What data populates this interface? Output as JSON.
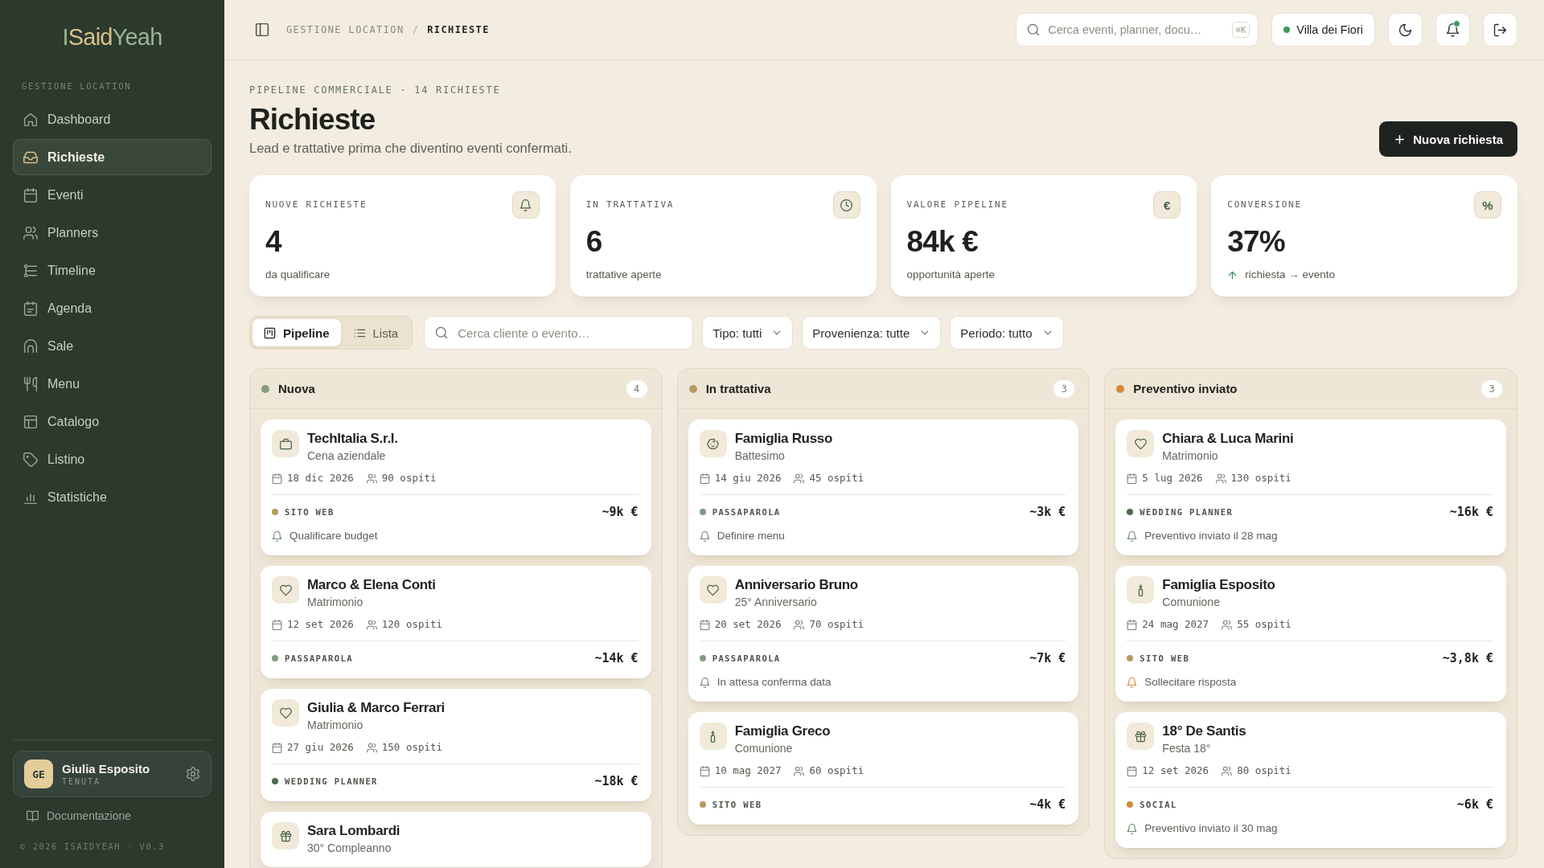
{
  "sidebar": {
    "logo": [
      "I",
      "Said",
      "Yeah"
    ],
    "section_label": "GESTIONE LOCATION",
    "items": [
      {
        "label": "Dashboard",
        "kind": "dashboard",
        "selected": false
      },
      {
        "label": "Richieste",
        "kind": "requests",
        "selected": true
      },
      {
        "label": "Eventi",
        "kind": "events",
        "selected": false
      },
      {
        "label": "Planners",
        "kind": "planners",
        "selected": false
      },
      {
        "label": "Timeline",
        "kind": "timeline",
        "selected": false
      },
      {
        "label": "Agenda",
        "kind": "agenda",
        "selected": false
      },
      {
        "label": "Sale",
        "kind": "rooms",
        "selected": false
      },
      {
        "label": "Menu",
        "kind": "menu",
        "selected": false
      },
      {
        "label": "Catalogo",
        "kind": "catalog",
        "selected": false
      },
      {
        "label": "Listino",
        "kind": "pricing",
        "selected": false
      },
      {
        "label": "Statistiche",
        "kind": "stats",
        "selected": false
      }
    ],
    "user": {
      "initials": "GE",
      "name": "Giulia Esposito",
      "role": "TENUTA"
    },
    "docs_link": "Documentazione",
    "footer": "© 2026 ISAIDYEAH · V0.3"
  },
  "topbar": {
    "breadcrumb": [
      {
        "label": "GESTIONE LOCATION",
        "current": false
      },
      {
        "label": "RICHIESTE",
        "current": true
      }
    ],
    "breadcrumb_separator": "/",
    "search": {
      "placeholder": "Cerca eventi, planner, docu…",
      "shortcut": "⌘K"
    },
    "venue": {
      "label": "Villa dei Fiori",
      "online": true
    },
    "actions": [
      {
        "kind": "theme"
      },
      {
        "kind": "notifications",
        "unread": true
      },
      {
        "kind": "logout"
      }
    ]
  },
  "header": {
    "eyebrow": "PIPELINE COMMERCIALE · 14 RICHIESTE",
    "title": "Richieste",
    "subtitle": "Lead e trattative prima che diventino eventi confermati.",
    "primary_button": "Nuova richiesta"
  },
  "stats": [
    {
      "kind": "new",
      "label": "NUOVE RICHIESTE",
      "value": "4",
      "caption": "da qualificare"
    },
    {
      "kind": "negotiation",
      "label": "IN TRATTATIVA",
      "value": "6",
      "caption": "trattative aperte"
    },
    {
      "kind": "value",
      "label": "VALORE PIPELINE",
      "value": "84k €",
      "caption": "opportunità aperte",
      "symbol": "€"
    },
    {
      "kind": "conversion",
      "label": "CONVERSIONE",
      "value": "37%",
      "caption": "richiesta → evento",
      "symbol": "%",
      "trend_up": true
    }
  ],
  "filters": {
    "views": [
      {
        "label": "Pipeline",
        "kind": "board",
        "selected": true
      },
      {
        "label": "Lista",
        "kind": "list",
        "selected": false
      }
    ],
    "search": {
      "placeholder": "Cerca cliente o evento…"
    },
    "dropdowns": [
      "Tipo: tutti",
      "Provenienza: tutte",
      "Periodo: tutto"
    ]
  },
  "columns": [
    {
      "title": "Nuova",
      "color": "#7f9c80",
      "count": "4",
      "cards": [
        {
          "kind": "corporate",
          "name": "TechItalia S.r.l.",
          "type": "Cena aziendale",
          "date": "18 dic 2026",
          "guests": "90 ospiti",
          "source": {
            "label": "SITO WEB",
            "color": "#b99a62"
          },
          "amount": "~9k €",
          "note": {
            "text": "Qualificare budget",
            "urgent": false
          }
        },
        {
          "kind": "wedding",
          "name": "Marco & Elena Conti",
          "type": "Matrimonio",
          "date": "12 set 2026",
          "guests": "120 ospiti",
          "source": {
            "label": "PASSAPAROLA",
            "color": "#7f9c80"
          },
          "amount": "~14k €"
        },
        {
          "kind": "wedding",
          "name": "Giulia & Marco Ferrari",
          "type": "Matrimonio",
          "date": "27 giu 2026",
          "guests": "150 ospiti",
          "source": {
            "label": "WEDDING PLANNER",
            "color": "#4c6a4e"
          },
          "amount": "~18k €"
        },
        {
          "kind": "birthday",
          "name": "Sara Lombardi",
          "type": "30° Compleanno"
        }
      ]
    },
    {
      "title": "In trattativa",
      "color": "#b99a62",
      "count": "3",
      "cards": [
        {
          "kind": "baptism",
          "name": "Famiglia Russo",
          "type": "Battesimo",
          "date": "14 giu 2026",
          "guests": "45 ospiti",
          "source": {
            "label": "PASSAPAROLA",
            "color": "#7f9c80"
          },
          "amount": "~3k €",
          "note": {
            "text": "Definire menu",
            "urgent": false
          }
        },
        {
          "kind": "anniversary",
          "name": "Anniversario Bruno",
          "type": "25° Anniversario",
          "date": "20 set 2026",
          "guests": "70 ospiti",
          "source": {
            "label": "PASSAPAROLA",
            "color": "#7f9c80"
          },
          "amount": "~7k €",
          "note": {
            "text": "In attesa conferma data",
            "urgent": false
          }
        },
        {
          "kind": "communion",
          "name": "Famiglia Greco",
          "type": "Comunione",
          "date": "10 mag 2027",
          "guests": "60 ospiti",
          "source": {
            "label": "SITO WEB",
            "color": "#b99a62"
          },
          "amount": "~4k €"
        }
      ]
    },
    {
      "title": "Preventivo inviato",
      "color": "#d18b3c",
      "count": "3",
      "cards": [
        {
          "kind": "wedding",
          "name": "Chiara & Luca Marini",
          "type": "Matrimonio",
          "date": "5 lug 2026",
          "guests": "130 ospiti",
          "source": {
            "label": "WEDDING PLANNER",
            "color": "#4c6a4e"
          },
          "amount": "~16k €",
          "note": {
            "text": "Preventivo inviato il 28 mag",
            "urgent": false
          }
        },
        {
          "kind": "communion",
          "name": "Famiglia Esposito",
          "type": "Comunione",
          "date": "24 mag 2027",
          "guests": "55 ospiti",
          "source": {
            "label": "SITO WEB",
            "color": "#b99a62"
          },
          "amount": "~3,8k €",
          "note": {
            "text": "Sollecitare risposta",
            "urgent": true
          }
        },
        {
          "kind": "birthday",
          "name": "18° De Santis",
          "type": "Festa 18°",
          "date": "12 set 2026",
          "guests": "80 ospiti",
          "source": {
            "label": "SOCIAL",
            "color": "#d18b3c"
          },
          "amount": "~6k €",
          "note": {
            "text": "Preventivo inviato il 30 mag",
            "urgent": false
          }
        }
      ]
    }
  ]
}
